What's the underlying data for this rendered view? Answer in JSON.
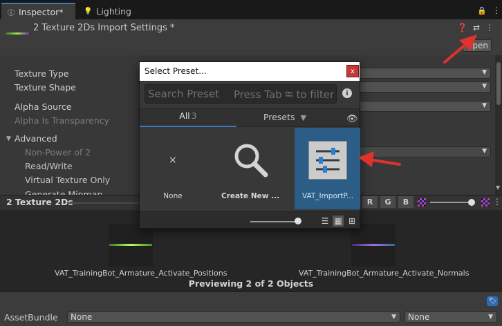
{
  "tabs": [
    {
      "label": "Inspector*",
      "icon": "info-icon"
    },
    {
      "label": "Lighting",
      "icon": "lightbulb-icon"
    }
  ],
  "header": {
    "title": "2 Texture 2Ds Import Settings *",
    "open_label": "Open"
  },
  "inspector": {
    "texture_type": "Texture Type",
    "texture_shape": "Texture Shape",
    "alpha_source": "Alpha Source",
    "alpha_is_transparency": "Alpha Is Transparency",
    "advanced": "Advanced",
    "non_power_of_2": "Non-Power of 2",
    "read_write": "Read/Write",
    "virtual_texture_only": "Virtual Texture Only",
    "generate_mipmap": "Generate Mipmap"
  },
  "preview": {
    "title": "2 Texture 2Ds",
    "channels": [
      "R",
      "G",
      "B"
    ],
    "textures": [
      "VAT_TrainingBot_Armature_Activate_Positions",
      "VAT_TrainingBot_Armature_Activate_Normals"
    ],
    "count_label": "Previewing 2 of 2 Objects"
  },
  "asset_bundle": {
    "label": "AssetBundle",
    "name_value": "None",
    "variant_value": "None"
  },
  "preset_dialog": {
    "title": "Select Preset...",
    "close_label": "x",
    "search_placeholder": "Search Preset",
    "search_hint": "Press Tab ⭾ to filter",
    "tab_all": "All",
    "tab_all_count": "3",
    "tab_presets": "Presets",
    "items": [
      {
        "label": "None",
        "icon": "close-icon"
      },
      {
        "label": "Create New ...",
        "icon": "search-icon"
      },
      {
        "label": "VAT_ImportP...",
        "icon": "sliders-icon"
      }
    ],
    "selected_item": "VAT_ImportP..."
  },
  "colors": {
    "accent": "#3a79bb",
    "selection": "#2c5d87",
    "close": "#c23a3a",
    "annotation_arrow": "#e0322d"
  }
}
